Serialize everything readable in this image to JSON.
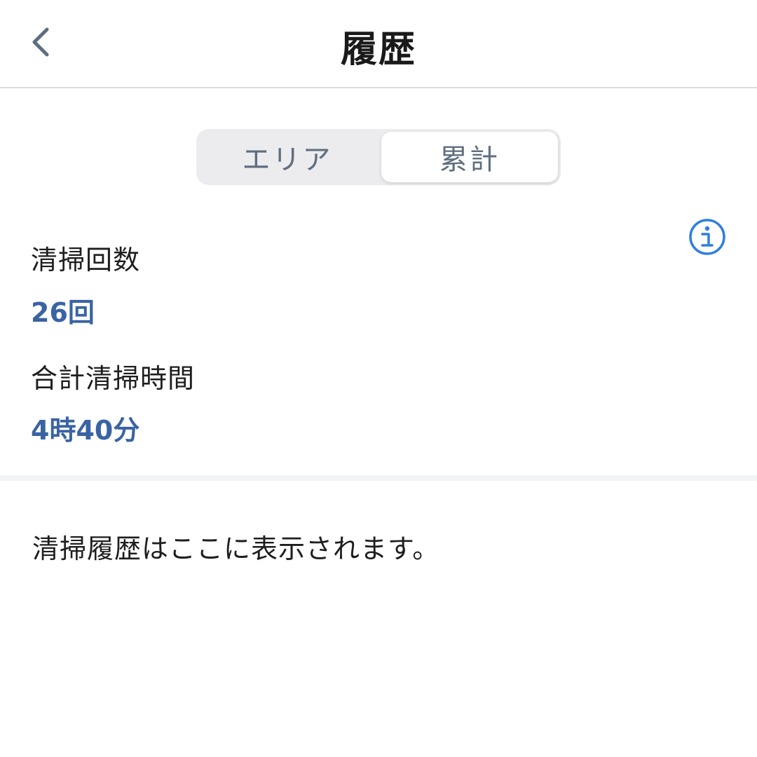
{
  "header": {
    "title": "履歴",
    "back_icon": "chevron-left-icon"
  },
  "segmented_control": {
    "options": [
      {
        "label": "エリア",
        "selected": false
      },
      {
        "label": "累計",
        "selected": true
      }
    ]
  },
  "info_icon": "info-circle-icon",
  "stats": {
    "clean_count_label": "清掃回数",
    "clean_count_value": "26回",
    "total_time_label": "合計清掃時間",
    "total_time_value": "4時40分"
  },
  "history": {
    "empty_message": "清掃履歴はここに表示されます。"
  },
  "colors": {
    "accent": "#3a63a3",
    "info_icon": "#2f7fde",
    "back_icon": "#5e6e80",
    "segment_text": "#5e6e80"
  }
}
